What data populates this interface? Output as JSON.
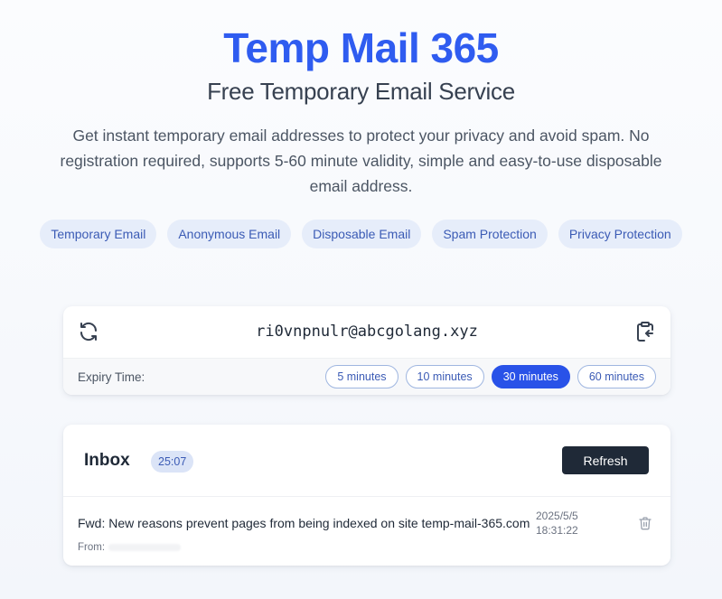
{
  "hero": {
    "title": "Temp Mail 365",
    "subtitle": "Free Temporary Email Service",
    "description": "Get instant temporary email addresses to protect your privacy and avoid spam. No registration required, supports 5-60 minute validity, simple and easy-to-use disposable email address.",
    "tags": [
      "Temporary Email",
      "Anonymous Email",
      "Disposable Email",
      "Spam Protection",
      "Privacy Protection"
    ]
  },
  "email_card": {
    "address": "ri0vnpnulr@abcgolang.xyz",
    "refresh_icon": "refresh-icon",
    "copy_icon": "clipboard-copy-icon",
    "expiry_label": "Expiry Time:",
    "expiry_options": [
      "5 minutes",
      "10 minutes",
      "30 minutes",
      "60 minutes"
    ],
    "selected_expiry": "30 minutes"
  },
  "inbox": {
    "title": "Inbox",
    "timer": "25:07",
    "refresh_label": "Refresh",
    "messages": [
      {
        "subject": "Fwd: New reasons prevent pages from being indexed on site temp-mail-365.com",
        "from_label": "From:",
        "date": "2025/5/5",
        "time": "18:31:22",
        "delete_icon": "trash-icon"
      }
    ]
  },
  "colors": {
    "accent": "#2952e8",
    "title": "#2f5cf0",
    "tag_bg": "#e6edfa",
    "dark_button": "#1f2937"
  }
}
